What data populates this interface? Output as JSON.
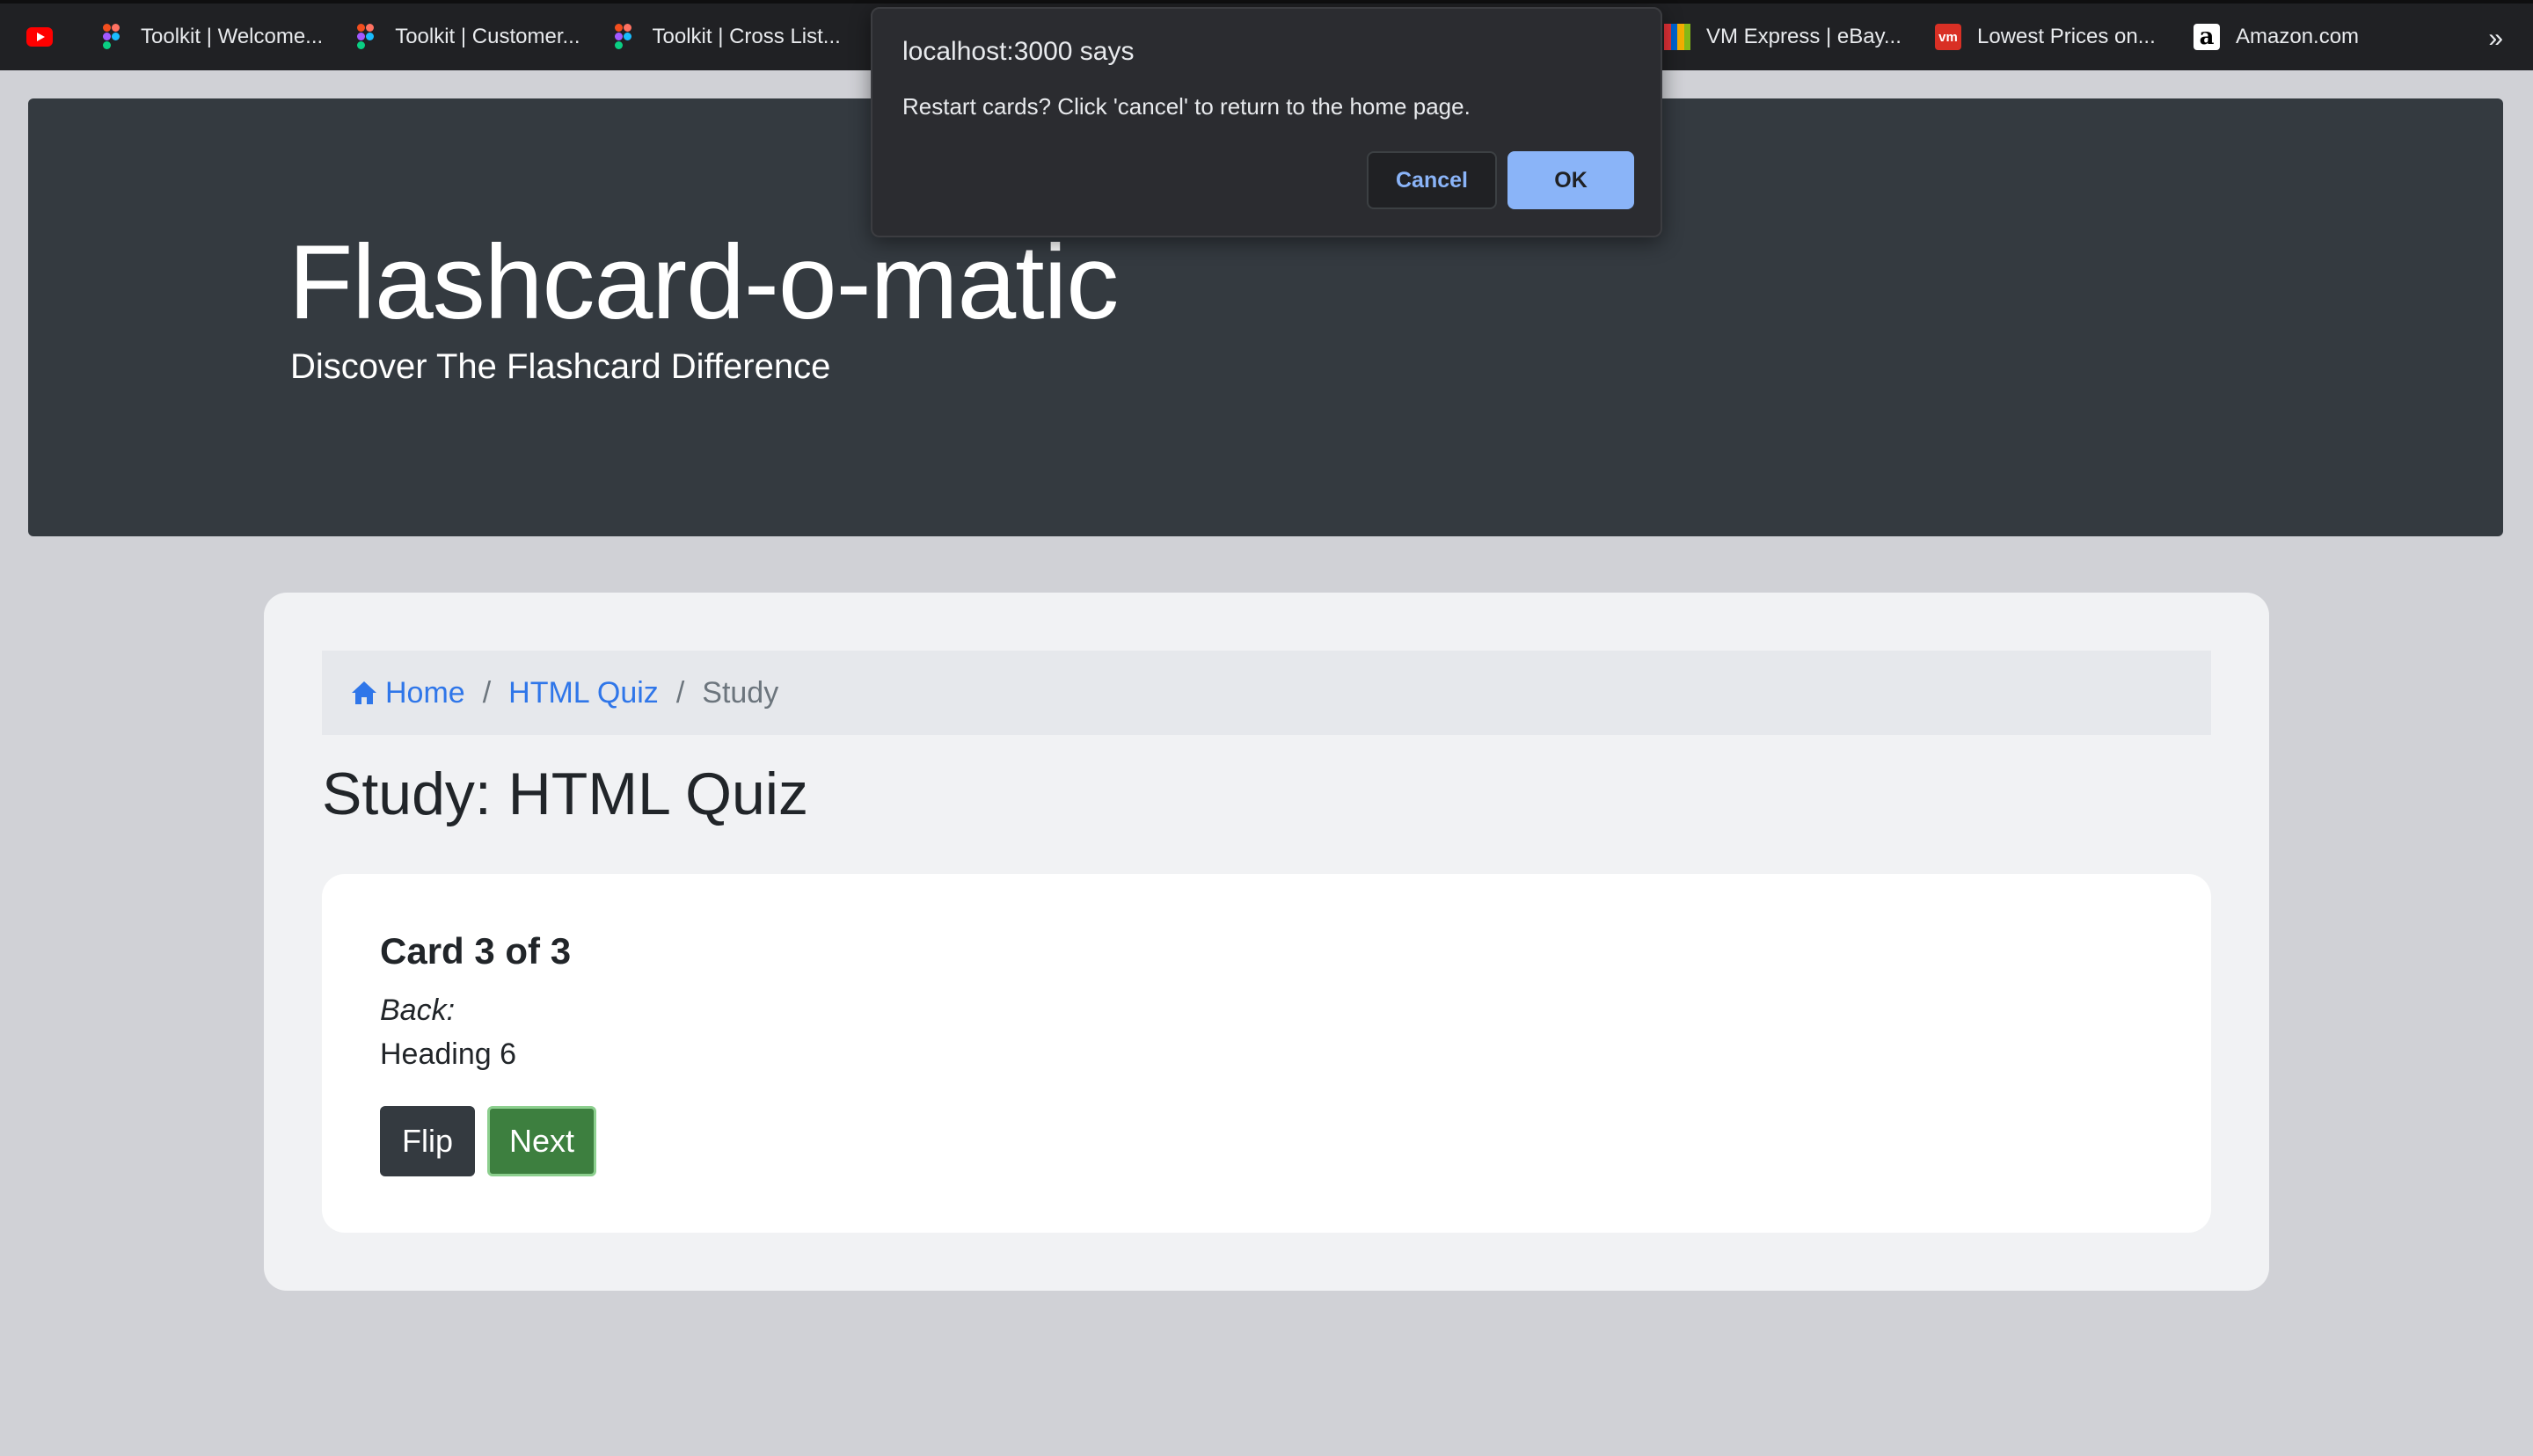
{
  "bookmarks": [
    {
      "icon": "youtube-icon",
      "label": ""
    },
    {
      "icon": "figma-icon",
      "label": "Toolkit | Welcome..."
    },
    {
      "icon": "figma-icon",
      "label": "Toolkit | Customer..."
    },
    {
      "icon": "figma-icon",
      "label": "Toolkit | Cross List..."
    },
    {
      "icon": "ebay-icon",
      "label": "VM Express | eBay..."
    },
    {
      "icon": "vm-icon",
      "label": "Lowest Prices on..."
    },
    {
      "icon": "amazon-icon",
      "label": "Amazon.com"
    }
  ],
  "bookmarks_overflow": "»",
  "icon_glyphs": {
    "vm": "vm",
    "amazon": "a"
  },
  "jumbotron": {
    "title": "Flashcard-o-matic",
    "subtitle": "Discover The Flashcard Difference"
  },
  "breadcrumb": {
    "home": "Home",
    "deck": "HTML Quiz",
    "current": "Study",
    "separator": "/"
  },
  "page_title": "Study: HTML Quiz",
  "card": {
    "title": "Card 3 of 3",
    "side_label": "Back:",
    "text": "Heading 6",
    "flip_label": "Flip",
    "next_label": "Next"
  },
  "dialog": {
    "title": "localhost:3000 says",
    "message": "Restart cards? Click 'cancel' to return to the home page.",
    "cancel_label": "Cancel",
    "ok_label": "OK"
  },
  "colors": {
    "link": "#2f76e9",
    "jumbotron_bg": "#343a40",
    "next_button": "#3d7f3f",
    "dialog_ok": "#8ab4f8"
  }
}
